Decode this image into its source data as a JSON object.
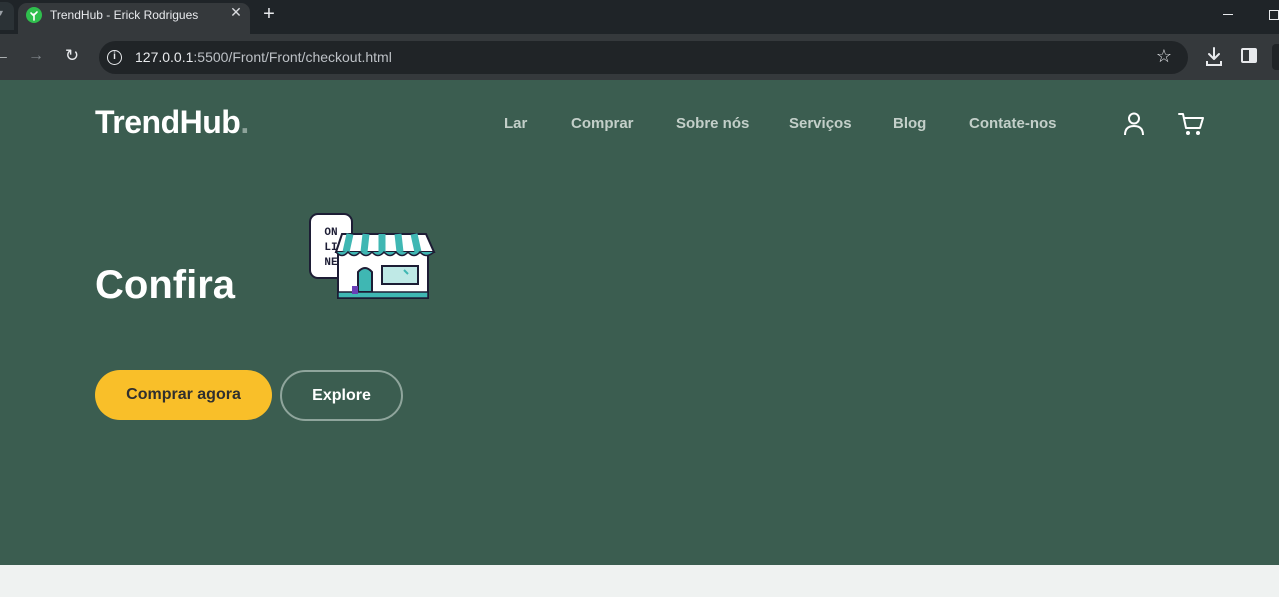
{
  "browser": {
    "tab_title": "TrendHub - Erick Rodrigues",
    "tab_close": "✕",
    "new_tab": "+",
    "url_host": "127.0.0.1",
    "url_rest": ":5500/Front/Front/checkout.html",
    "icons": [
      "back-icon",
      "forward-icon",
      "reload-icon",
      "info-icon",
      "star-icon",
      "download-icon",
      "side-panel-icon"
    ]
  },
  "site": {
    "logo_text": "TrendHub",
    "logo_dot": ".",
    "nav": [
      "Lar",
      "Comprar",
      "Sobre nós",
      "Serviços",
      "Blog",
      "Contate-nos"
    ],
    "icons": [
      "user-icon",
      "cart-icon"
    ]
  },
  "hero": {
    "title": "Confira",
    "illustration_text": [
      "ON",
      "LI",
      "NE"
    ],
    "primary_button": "Comprar agora",
    "secondary_button": "Explore"
  },
  "colors": {
    "hero_bg": "#3b5d50",
    "accent": "#f9bf29",
    "page_bg": "#eff2f1",
    "browser_frame": "#1f2428"
  }
}
